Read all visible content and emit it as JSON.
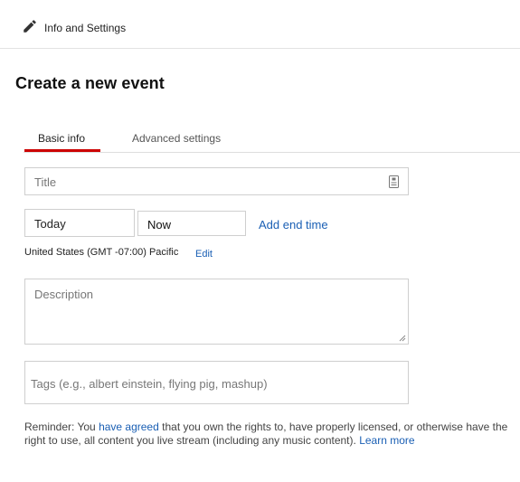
{
  "header": {
    "title": "Info and Settings",
    "icon": "pencil-icon"
  },
  "page_title": "Create a new event",
  "tabs": [
    {
      "label": "Basic info",
      "active": true
    },
    {
      "label": "Advanced settings",
      "active": false
    }
  ],
  "form": {
    "title_placeholder": "Title",
    "title_icon": "document-icon",
    "date_value": "Today",
    "time_value": "Now",
    "add_end_time": "Add end time",
    "timezone": "United States (GMT -07:00) Pacific",
    "timezone_edit": "Edit",
    "description_placeholder": "Description",
    "tags_placeholder": "Tags (e.g., albert einstein, flying pig, mashup)"
  },
  "reminder": {
    "prefix": "Reminder: You ",
    "link1": "have agreed",
    "middle": " that you own the rights to, have properly licensed, or otherwise have the right to use, all content you live stream (including any music content). ",
    "link2": "Learn more"
  },
  "colors": {
    "accent_red": "#cc0000",
    "link_blue": "#1a5fb4"
  }
}
